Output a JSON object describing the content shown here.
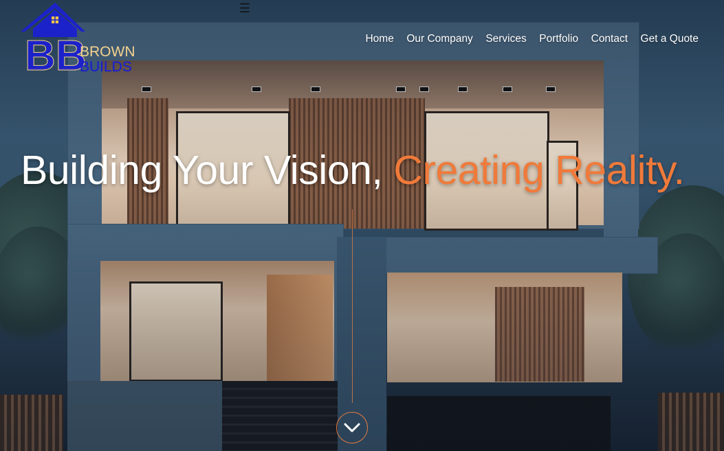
{
  "brand": {
    "initials": "BB",
    "line1": "BROWN",
    "line2": "BUILDS",
    "colors": {
      "blue": "#1c22c9",
      "gold": "#f3d38f",
      "orange_gradient": "#f07a3a",
      "window": "#f5c548"
    }
  },
  "header": {
    "menu_toggle": "☰",
    "nav": [
      {
        "label": "Home"
      },
      {
        "label": "Our Company"
      },
      {
        "label": "Services"
      },
      {
        "label": "Portfolio"
      },
      {
        "label": "Contact"
      },
      {
        "label": "Get a Quote"
      }
    ]
  },
  "hero": {
    "headline_main": "Building Your Vision, ",
    "headline_accent": "Creating Reality.",
    "scroll_icon": "chevron-down-icon",
    "accent_color": "#f07a3a"
  }
}
